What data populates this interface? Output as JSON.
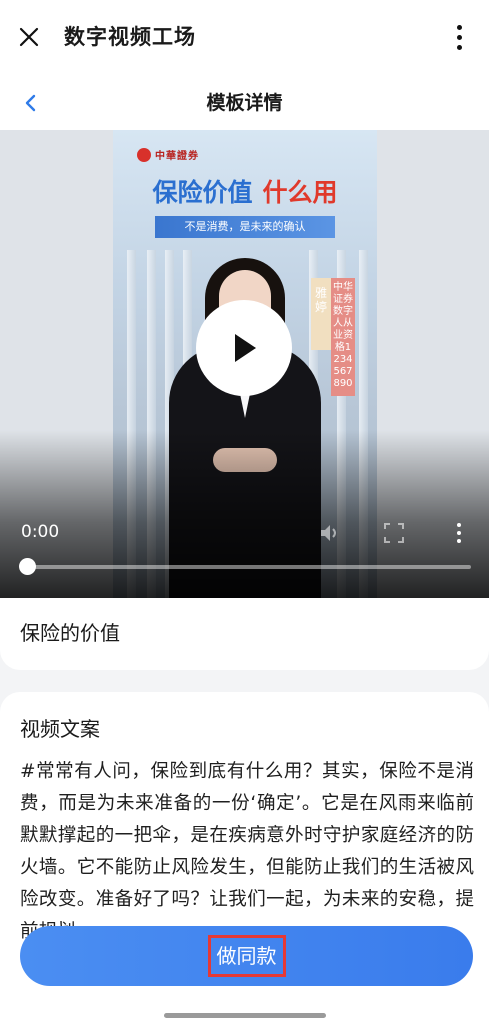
{
  "header": {
    "app_title": "数字视频工场",
    "page_title": "模板详情"
  },
  "video": {
    "time": "0:00",
    "progress": 0,
    "poster": {
      "brand": "中華證券",
      "headline_blue": "保险价值",
      "headline_red": "什么用",
      "subtitle": "不是消费，是未来的确认",
      "tag_name": "雅婷",
      "tag_cert": "中华证券数字人从业资格1234567890"
    }
  },
  "template": {
    "title": "保险的价值"
  },
  "copy_section": {
    "heading": "视频文案",
    "body": "#常常有人问，保险到底有什么用？其实，保险不是消费，而是为未来准备的一份‘确定’。它是在风雨来临前默默撑起的一把伞，是在疾病意外时守护家庭经济的防火墙。它不能防止风险发生，但能防止我们的生活被风险改变。准备好了吗？让我们一起，为未来的安稳，提前规划。"
  },
  "cta": {
    "label": "做同款"
  },
  "colors": {
    "accent": "#3a7cec",
    "highlight_border": "#e53935"
  },
  "icons": [
    "close-icon",
    "more-vertical-icon",
    "chevron-left-icon",
    "play-icon",
    "volume-icon",
    "fullscreen-icon"
  ]
}
